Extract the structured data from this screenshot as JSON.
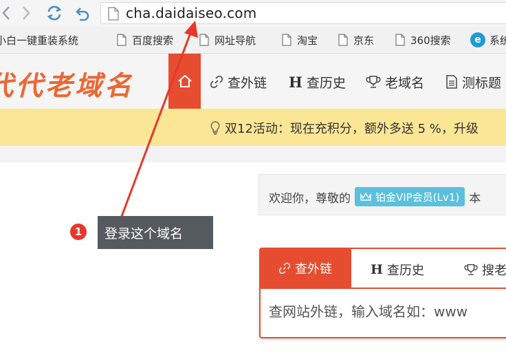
{
  "browser": {
    "url": "cha.daidaiseo.com",
    "bookmarks": [
      {
        "label": "小白一键重装系统",
        "icon": "doc-icon"
      },
      {
        "label": "百度搜索",
        "icon": "doc-icon"
      },
      {
        "label": "网址导航",
        "icon": "doc-icon"
      },
      {
        "label": "淘宝",
        "icon": "doc-icon"
      },
      {
        "label": "京东",
        "icon": "doc-icon"
      },
      {
        "label": "360搜索",
        "icon": "doc-icon"
      },
      {
        "label": "系统",
        "icon": "app-logo-icon"
      }
    ]
  },
  "site": {
    "logo_text": "代代老域名",
    "nav": [
      {
        "label": "查外链",
        "icon": "link-icon"
      },
      {
        "label": "查历史",
        "icon": "h-icon"
      },
      {
        "label": "老域名",
        "icon": "trophy-icon"
      },
      {
        "label": "测标题",
        "icon": "document-icon"
      }
    ],
    "promo_text": "双12活动：现在充积分，额外多送 5 %，升级"
  },
  "welcome": {
    "prefix": "欢迎你，尊敬的",
    "vip_label": "铂金VIP会员(Lv1)",
    "suffix": "本"
  },
  "search": {
    "tabs": [
      {
        "label": "查外链",
        "icon": "link-icon",
        "active": true
      },
      {
        "label": "查历史",
        "icon": "h-icon",
        "active": false
      },
      {
        "label": "搜老",
        "icon": "trophy-icon",
        "active": false
      }
    ],
    "placeholder": "查网站外链，输入域名如：www"
  },
  "annotation": {
    "step": "1",
    "text": "登录这个域名"
  },
  "colors": {
    "accent": "#e64c2f",
    "promo_bg": "#fbe696",
    "vip_badge": "#5bc0de",
    "annotation_arrow": "#e8372a",
    "tooltip_bg": "#555a5e"
  }
}
